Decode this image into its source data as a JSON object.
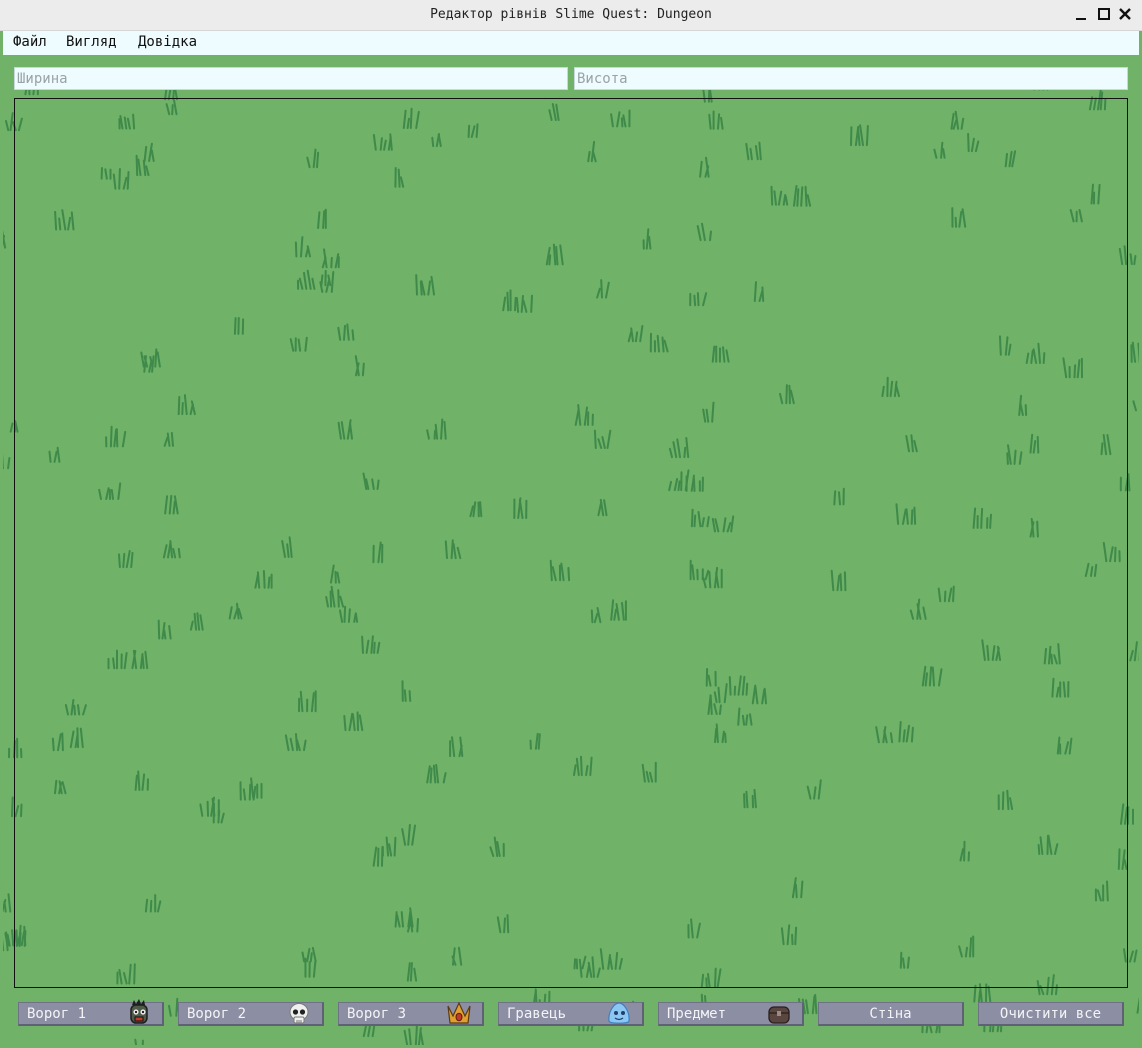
{
  "window": {
    "title": "Редактор рівнів Slime Quest: Dungeon"
  },
  "menu": {
    "items": [
      "Файл",
      "Вигляд",
      "Довідка"
    ]
  },
  "inputs": {
    "width": {
      "placeholder": "Ширина",
      "value": ""
    },
    "height": {
      "placeholder": "Висота",
      "value": ""
    }
  },
  "toolbar": {
    "buttons": [
      {
        "label": "Ворог 1",
        "icon": "zombie-icon"
      },
      {
        "label": "Ворог 2",
        "icon": "skull-icon"
      },
      {
        "label": "Ворог 3",
        "icon": "crown-icon"
      },
      {
        "label": "Гравець",
        "icon": "slime-icon"
      },
      {
        "label": "Предмет",
        "icon": "chest-icon"
      },
      {
        "label": "Стіна",
        "icon": ""
      },
      {
        "label": "Очистити все",
        "icon": ""
      }
    ]
  },
  "colors": {
    "grass_background": "#6fb268",
    "grass_tuft": "#3f8a4a",
    "menu_background": "#eefcff",
    "button_background": "#8c8ea4"
  }
}
